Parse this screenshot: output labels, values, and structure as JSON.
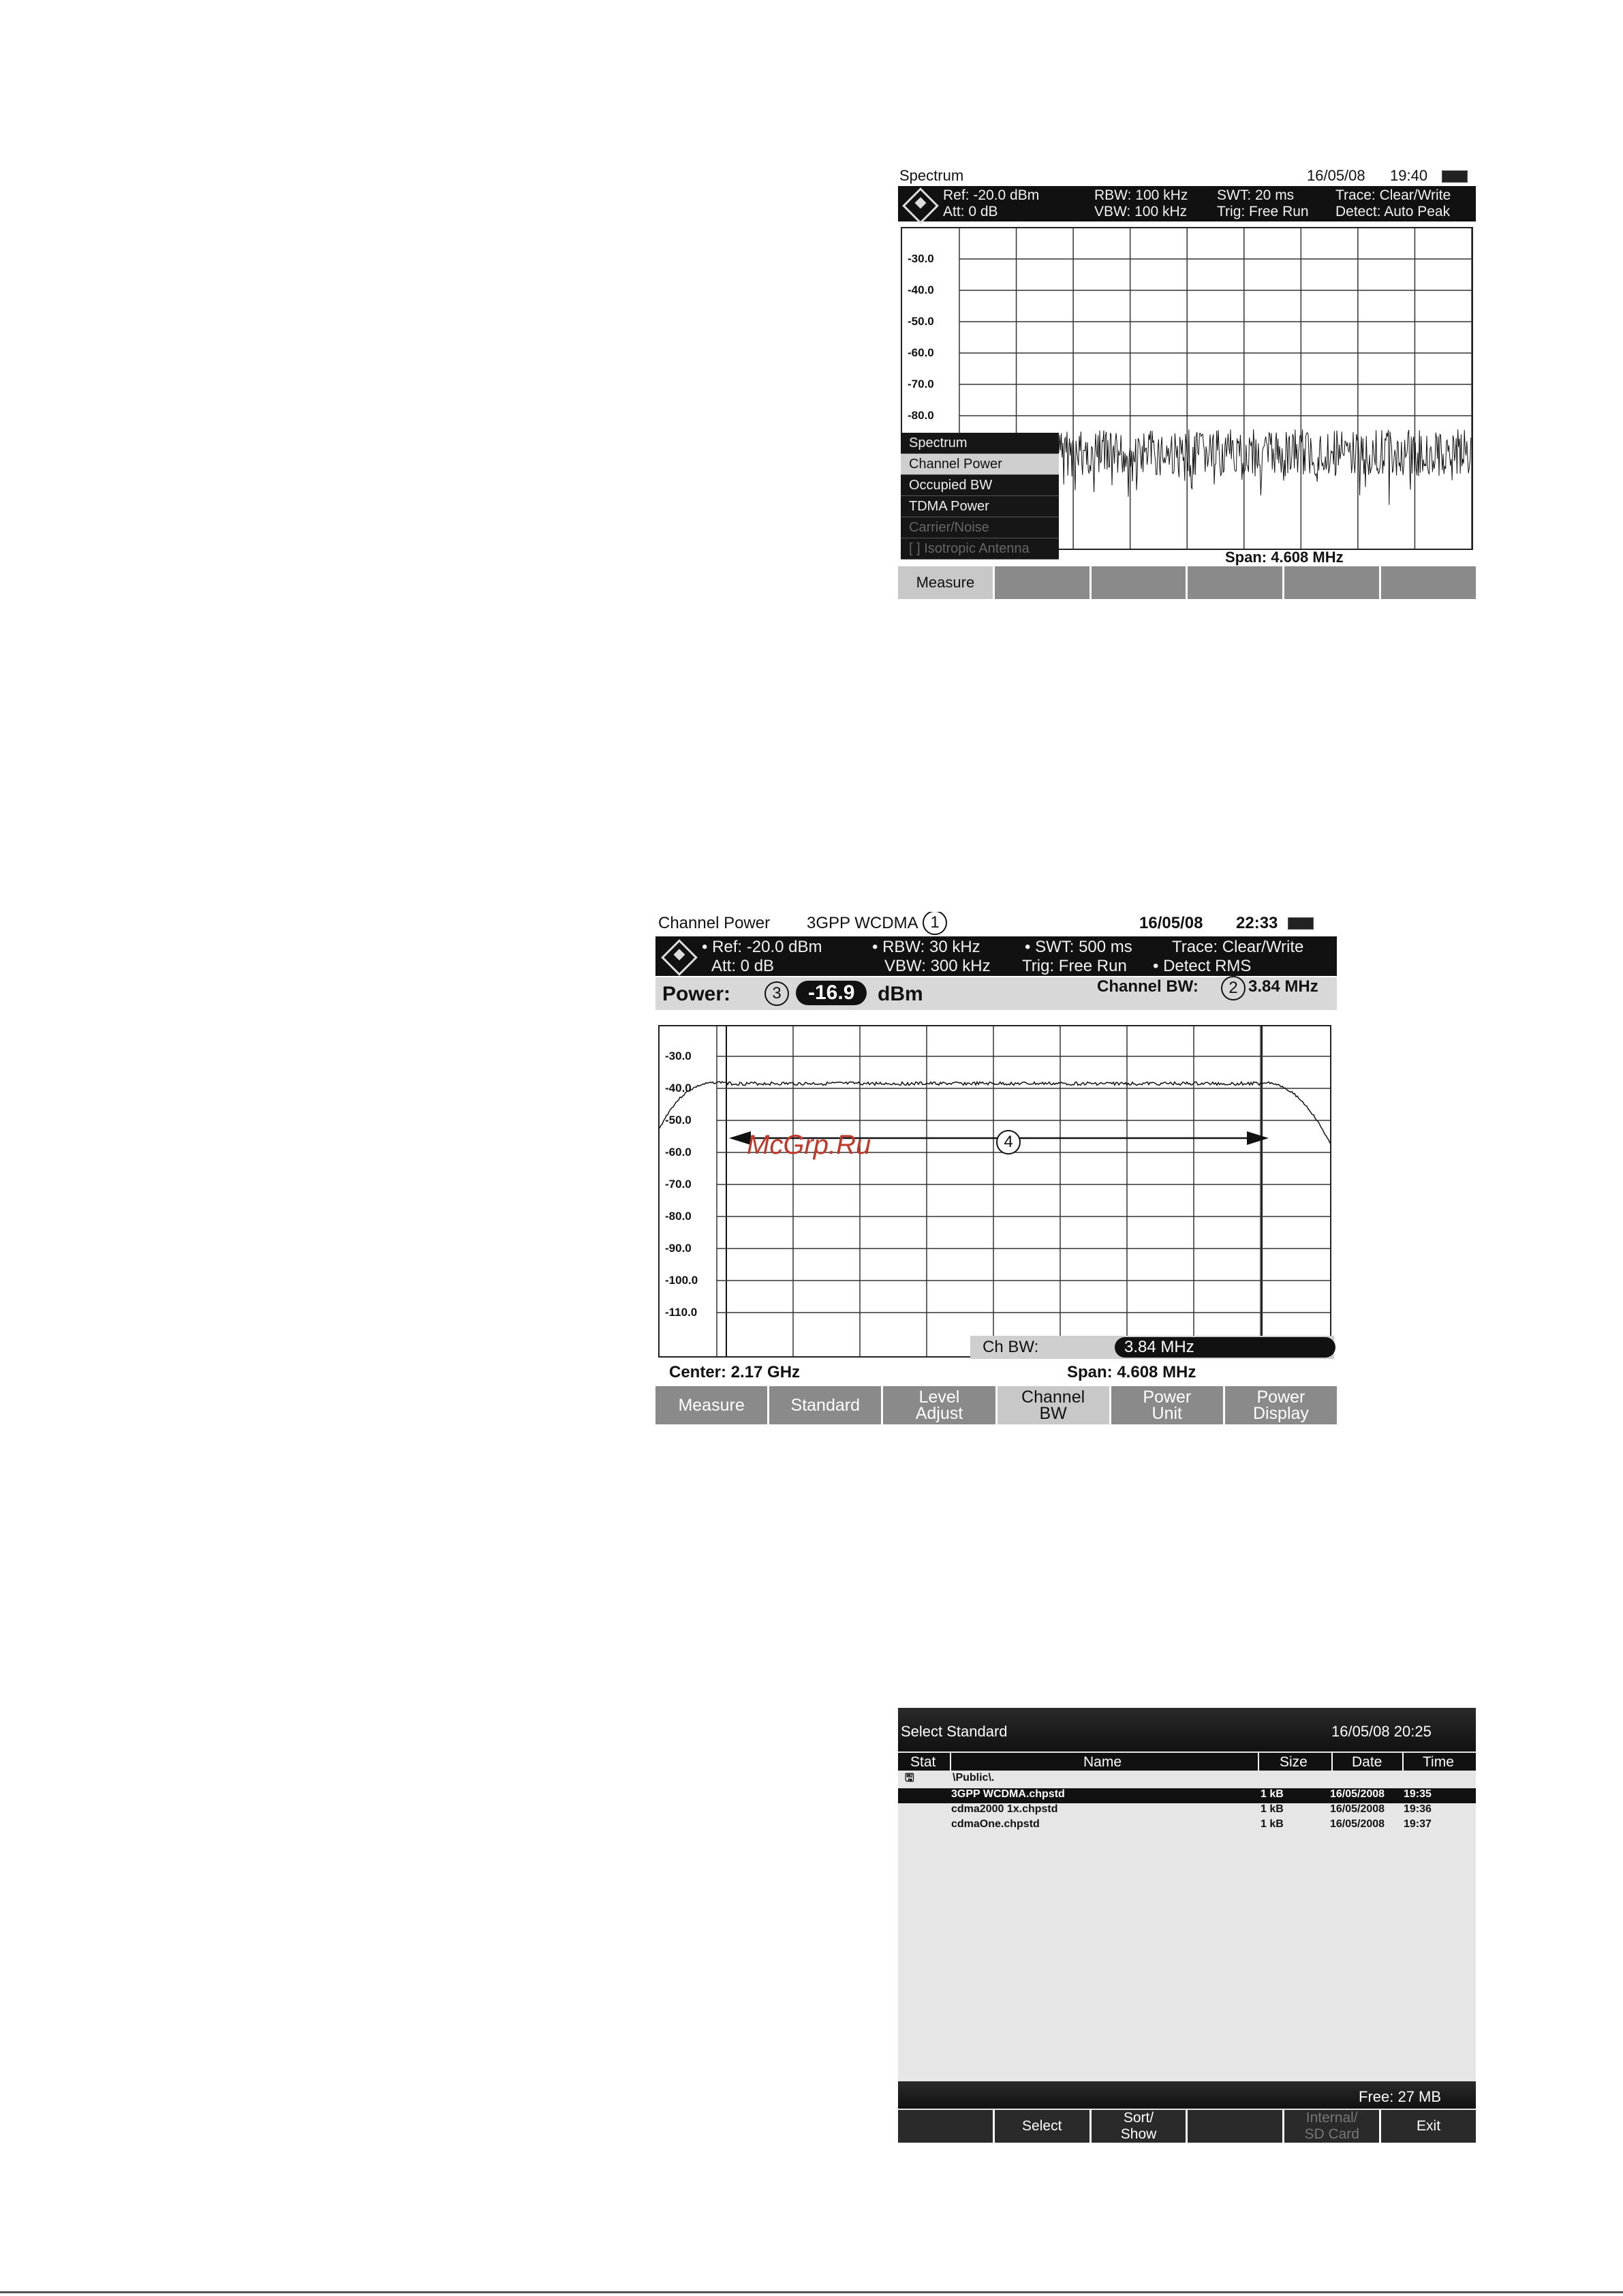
{
  "screen1": {
    "title": "Spectrum",
    "date": "16/05/08",
    "time": "19:40",
    "hdr": {
      "ref": "Ref: -20.0 dBm",
      "att": "Att: 0 dB",
      "rbw": "RBW: 100 kHz",
      "vbw": "VBW: 100 kHz",
      "swt": "SWT: 20 ms",
      "trig": "Trig: Free Run",
      "trace": "Trace: Clear/Write",
      "detect": "Detect: Auto Peak"
    },
    "y_labels": [
      "-30.0",
      "-40.0",
      "-50.0",
      "-60.0",
      "-70.0",
      "-80.0"
    ],
    "menu": [
      "Spectrum",
      "Channel Power",
      "Occupied BW",
      "TDMA Power",
      "Carrier/Noise",
      "[ ] Isotropic Antenna"
    ],
    "span": "Span:  4.608 MHz",
    "softkeys": [
      "Measure",
      "",
      "",
      "",
      "",
      ""
    ]
  },
  "screen2": {
    "title": "Channel Power",
    "standard": "3GPP WCDMA",
    "callout1": "1",
    "date": "16/05/08",
    "time": "22:33",
    "hdr": {
      "ref": "• Ref: -20.0 dBm",
      "att": "Att: 0 dB",
      "rbw": "• RBW: 30 kHz",
      "vbw": "VBW: 300 kHz",
      "swt": "• SWT: 500 ms",
      "trig": "Trig: Free Run",
      "trace": "Trace: Clear/Write",
      "detect": "• Detect RMS"
    },
    "power_label": "Power:",
    "callout3": "3",
    "power_value": "-16.9",
    "power_unit": "dBm",
    "chbw_label": "Channel BW:",
    "callout2": "2",
    "chbw_value": "3.84 MHz",
    "y_labels": [
      "-30.0",
      "-40.0",
      "-50.0",
      "-60.0",
      "-70.0",
      "-80.0",
      "-90.0",
      "-100.0",
      "-110.0"
    ],
    "callout4": "4",
    "input_label": "Ch BW:",
    "input_value": "3.84 MHz",
    "center": "Center: 2.17 GHz",
    "span": "Span:    4.608 MHz",
    "softkeys": [
      "Measure",
      "Standard",
      "Level\nAdjust",
      "Channel\nBW",
      "Power\nUnit",
      "Power\nDisplay"
    ]
  },
  "screen3": {
    "title": "Select Standard",
    "datetime": "16/05/08 20:25",
    "columns": [
      "Stat",
      "Name",
      "Size",
      "Date",
      "Time"
    ],
    "folder": "\\Public\\.",
    "rows": [
      {
        "name": "3GPP WCDMA.chpstd",
        "size": "1 kB",
        "date": "16/05/2008",
        "time": "19:35"
      },
      {
        "name": "cdma2000 1x.chpstd",
        "size": "1 kB",
        "date": "16/05/2008",
        "time": "19:36"
      },
      {
        "name": "cdmaOne.chpstd",
        "size": "1 kB",
        "date": "16/05/2008",
        "time": "19:37"
      }
    ],
    "free": "Free: 27 MB",
    "softkeys": [
      "",
      "Select",
      "Sort/\nShow",
      "",
      "Internal/\nSD Card",
      "Exit"
    ]
  },
  "watermark": "McGrp.Ru"
}
